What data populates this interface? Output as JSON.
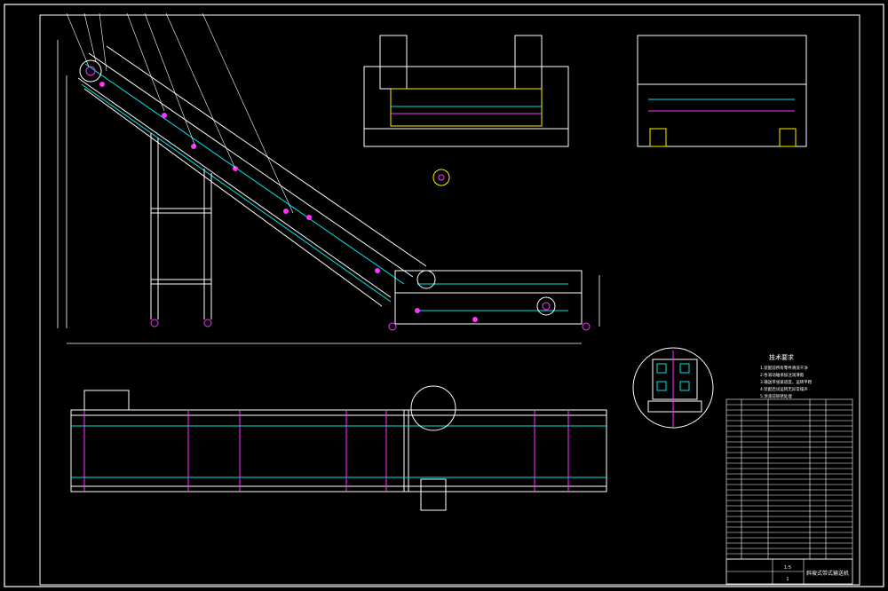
{
  "colors": {
    "background": "#000000",
    "frame": "#ffffff",
    "outline": "#ffffff",
    "cyan": "#00e5e5",
    "magenta": "#ff33ff",
    "yellow": "#ffee00",
    "green": "#33ff33",
    "red": "#ff3333"
  },
  "drawing": {
    "technical_requirements_title": "技术要求",
    "technical_requirements_lines": [
      "1.装配前所有零件清洗干净",
      "2.各滚动轴承加注润滑脂",
      "3.输送带张紧适度，运转平稳",
      "4.装配后试运转无异常噪声",
      "5.涂漆前除锈处理"
    ],
    "title_block": {
      "drawing_name": "斜坡式带式输送机",
      "scale": "1:5",
      "sheet": "1"
    }
  }
}
